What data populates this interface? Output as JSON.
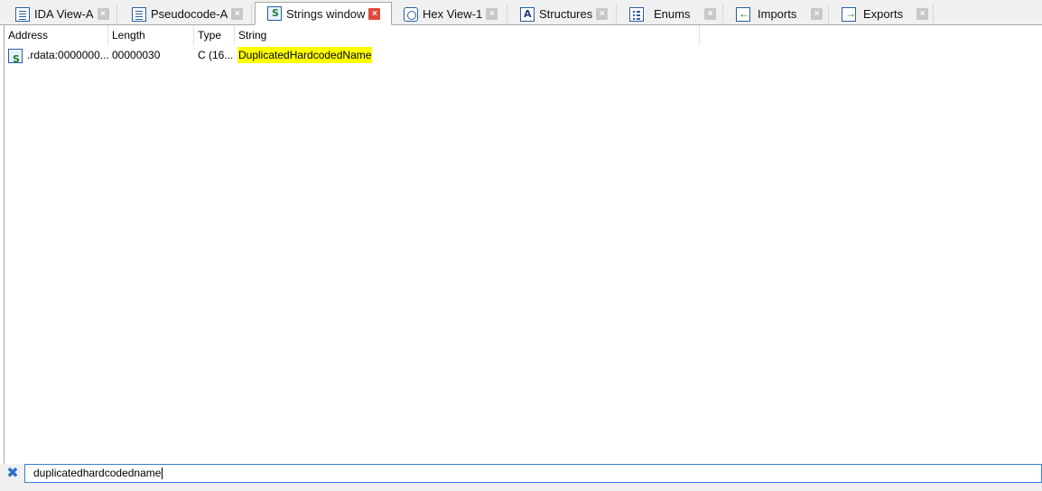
{
  "tabs": [
    {
      "label": "IDA View-A",
      "icon": "document-icon",
      "active": false
    },
    {
      "label": "Pseudocode-A",
      "icon": "document-icon",
      "active": false
    },
    {
      "label": "Strings window",
      "icon": "strings-icon",
      "active": true
    },
    {
      "label": "Hex View-1",
      "icon": "hex-icon",
      "active": false
    },
    {
      "label": "Structures",
      "icon": "structures-icon",
      "active": false
    },
    {
      "label": "Enums",
      "icon": "enums-icon",
      "active": false
    },
    {
      "label": "Imports",
      "icon": "imports-icon",
      "active": false
    },
    {
      "label": "Exports",
      "icon": "exports-icon",
      "active": false
    }
  ],
  "table": {
    "columns": [
      "Address",
      "Length",
      "Type",
      "String"
    ],
    "rows": [
      {
        "address": ".rdata:0000000...",
        "length": "00000030",
        "type": "C (16...",
        "string": "DuplicatedHardcodedName",
        "icon": "string-entry-icon"
      }
    ]
  },
  "filter": {
    "value": "duplicatedhardcodedname",
    "clear_icon": "clear-filter-icon"
  },
  "colors": {
    "highlight": "#ffff00",
    "active_close": "#e04a3a",
    "input_border": "#3c7fd4"
  }
}
